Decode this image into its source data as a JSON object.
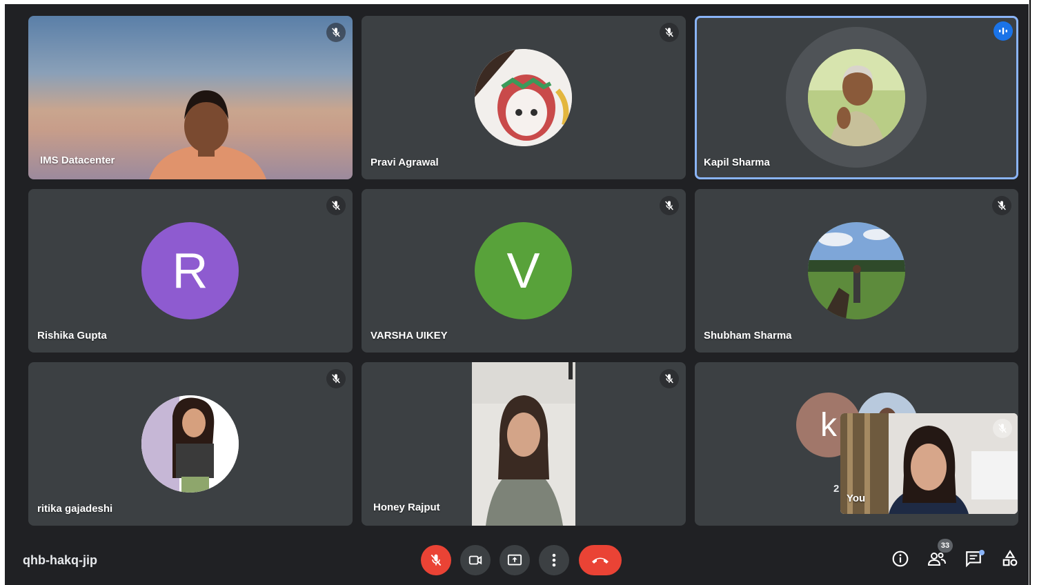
{
  "meeting_code": "qhb-hakq-jip",
  "participant_count": "33",
  "colors": {
    "avatar_r": "#8e5bd0",
    "avatar_v": "#58a23a",
    "avatar_k": "#a1776a",
    "hangup": "#ea4335",
    "active_border": "#8ab4f8"
  },
  "tiles": [
    {
      "name": "IMS Datacenter",
      "muted": true,
      "video": true
    },
    {
      "name": "Pravi Agrawal",
      "muted": true,
      "avatar": "photo"
    },
    {
      "name": "Kapil Sharma",
      "speaking": true,
      "avatar": "photo"
    },
    {
      "name": "Rishika Gupta",
      "muted": true,
      "initial": "R"
    },
    {
      "name": "VARSHA UIKEY",
      "muted": true,
      "initial": "V"
    },
    {
      "name": "Shubham Sharma",
      "muted": true,
      "avatar": "photo"
    },
    {
      "name": "ritika gajadeshi",
      "muted": true,
      "avatar": "photo"
    },
    {
      "name": "Honey Rajput",
      "muted": true,
      "video": true
    },
    {
      "initial": "k",
      "others_count": "2"
    }
  ],
  "self_view": {
    "label": "You",
    "muted": true
  },
  "controls": {
    "mic": "mic-off-icon",
    "camera": "camera-icon",
    "present": "present-screen-icon",
    "more": "more-options-icon",
    "leave": "hang-up-icon"
  },
  "right_controls": [
    "info-icon",
    "people-icon",
    "chat-icon",
    "activities-icon"
  ]
}
